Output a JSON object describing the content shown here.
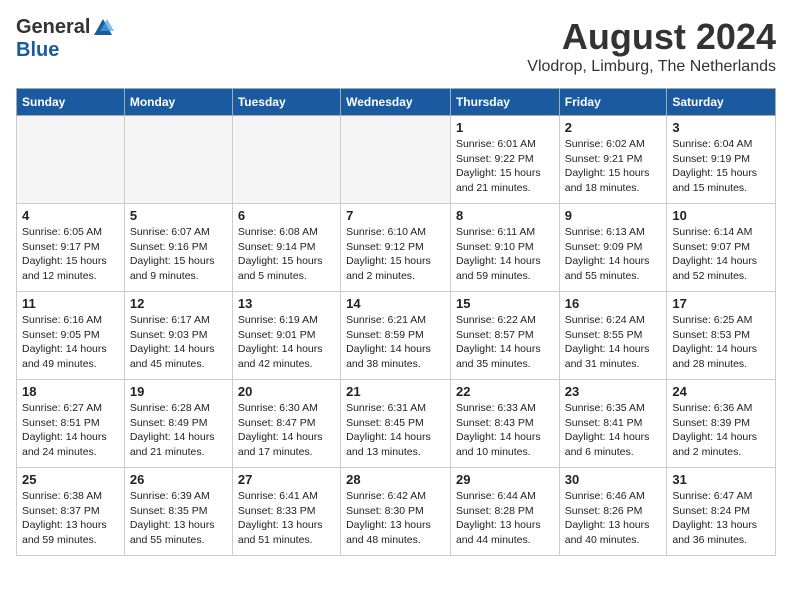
{
  "header": {
    "logo_general": "General",
    "logo_blue": "Blue",
    "month_year": "August 2024",
    "location": "Vlodrop, Limburg, The Netherlands"
  },
  "days_of_week": [
    "Sunday",
    "Monday",
    "Tuesday",
    "Wednesday",
    "Thursday",
    "Friday",
    "Saturday"
  ],
  "weeks": [
    [
      {
        "day": "",
        "info": ""
      },
      {
        "day": "",
        "info": ""
      },
      {
        "day": "",
        "info": ""
      },
      {
        "day": "",
        "info": ""
      },
      {
        "day": "1",
        "info": "Sunrise: 6:01 AM\nSunset: 9:22 PM\nDaylight: 15 hours\nand 21 minutes."
      },
      {
        "day": "2",
        "info": "Sunrise: 6:02 AM\nSunset: 9:21 PM\nDaylight: 15 hours\nand 18 minutes."
      },
      {
        "day": "3",
        "info": "Sunrise: 6:04 AM\nSunset: 9:19 PM\nDaylight: 15 hours\nand 15 minutes."
      }
    ],
    [
      {
        "day": "4",
        "info": "Sunrise: 6:05 AM\nSunset: 9:17 PM\nDaylight: 15 hours\nand 12 minutes."
      },
      {
        "day": "5",
        "info": "Sunrise: 6:07 AM\nSunset: 9:16 PM\nDaylight: 15 hours\nand 9 minutes."
      },
      {
        "day": "6",
        "info": "Sunrise: 6:08 AM\nSunset: 9:14 PM\nDaylight: 15 hours\nand 5 minutes."
      },
      {
        "day": "7",
        "info": "Sunrise: 6:10 AM\nSunset: 9:12 PM\nDaylight: 15 hours\nand 2 minutes."
      },
      {
        "day": "8",
        "info": "Sunrise: 6:11 AM\nSunset: 9:10 PM\nDaylight: 14 hours\nand 59 minutes."
      },
      {
        "day": "9",
        "info": "Sunrise: 6:13 AM\nSunset: 9:09 PM\nDaylight: 14 hours\nand 55 minutes."
      },
      {
        "day": "10",
        "info": "Sunrise: 6:14 AM\nSunset: 9:07 PM\nDaylight: 14 hours\nand 52 minutes."
      }
    ],
    [
      {
        "day": "11",
        "info": "Sunrise: 6:16 AM\nSunset: 9:05 PM\nDaylight: 14 hours\nand 49 minutes."
      },
      {
        "day": "12",
        "info": "Sunrise: 6:17 AM\nSunset: 9:03 PM\nDaylight: 14 hours\nand 45 minutes."
      },
      {
        "day": "13",
        "info": "Sunrise: 6:19 AM\nSunset: 9:01 PM\nDaylight: 14 hours\nand 42 minutes."
      },
      {
        "day": "14",
        "info": "Sunrise: 6:21 AM\nSunset: 8:59 PM\nDaylight: 14 hours\nand 38 minutes."
      },
      {
        "day": "15",
        "info": "Sunrise: 6:22 AM\nSunset: 8:57 PM\nDaylight: 14 hours\nand 35 minutes."
      },
      {
        "day": "16",
        "info": "Sunrise: 6:24 AM\nSunset: 8:55 PM\nDaylight: 14 hours\nand 31 minutes."
      },
      {
        "day": "17",
        "info": "Sunrise: 6:25 AM\nSunset: 8:53 PM\nDaylight: 14 hours\nand 28 minutes."
      }
    ],
    [
      {
        "day": "18",
        "info": "Sunrise: 6:27 AM\nSunset: 8:51 PM\nDaylight: 14 hours\nand 24 minutes."
      },
      {
        "day": "19",
        "info": "Sunrise: 6:28 AM\nSunset: 8:49 PM\nDaylight: 14 hours\nand 21 minutes."
      },
      {
        "day": "20",
        "info": "Sunrise: 6:30 AM\nSunset: 8:47 PM\nDaylight: 14 hours\nand 17 minutes."
      },
      {
        "day": "21",
        "info": "Sunrise: 6:31 AM\nSunset: 8:45 PM\nDaylight: 14 hours\nand 13 minutes."
      },
      {
        "day": "22",
        "info": "Sunrise: 6:33 AM\nSunset: 8:43 PM\nDaylight: 14 hours\nand 10 minutes."
      },
      {
        "day": "23",
        "info": "Sunrise: 6:35 AM\nSunset: 8:41 PM\nDaylight: 14 hours\nand 6 minutes."
      },
      {
        "day": "24",
        "info": "Sunrise: 6:36 AM\nSunset: 8:39 PM\nDaylight: 14 hours\nand 2 minutes."
      }
    ],
    [
      {
        "day": "25",
        "info": "Sunrise: 6:38 AM\nSunset: 8:37 PM\nDaylight: 13 hours\nand 59 minutes."
      },
      {
        "day": "26",
        "info": "Sunrise: 6:39 AM\nSunset: 8:35 PM\nDaylight: 13 hours\nand 55 minutes."
      },
      {
        "day": "27",
        "info": "Sunrise: 6:41 AM\nSunset: 8:33 PM\nDaylight: 13 hours\nand 51 minutes."
      },
      {
        "day": "28",
        "info": "Sunrise: 6:42 AM\nSunset: 8:30 PM\nDaylight: 13 hours\nand 48 minutes."
      },
      {
        "day": "29",
        "info": "Sunrise: 6:44 AM\nSunset: 8:28 PM\nDaylight: 13 hours\nand 44 minutes."
      },
      {
        "day": "30",
        "info": "Sunrise: 6:46 AM\nSunset: 8:26 PM\nDaylight: 13 hours\nand 40 minutes."
      },
      {
        "day": "31",
        "info": "Sunrise: 6:47 AM\nSunset: 8:24 PM\nDaylight: 13 hours\nand 36 minutes."
      }
    ]
  ]
}
